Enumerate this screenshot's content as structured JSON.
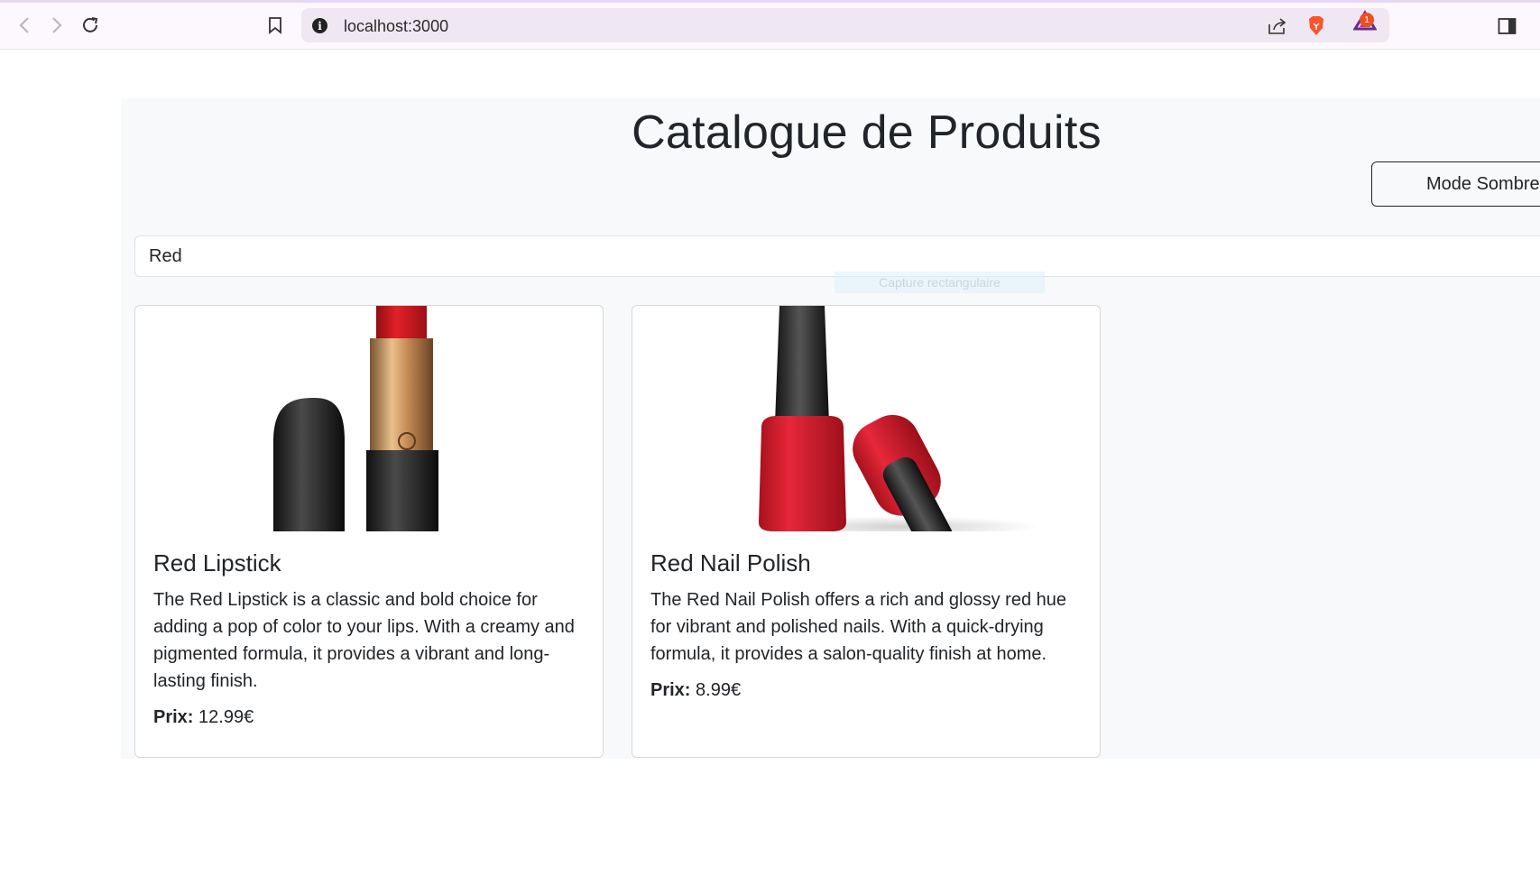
{
  "browser": {
    "url": "localhost:3000",
    "notification_count": "1",
    "icons": [
      "back-icon",
      "forward-icon",
      "reload-icon",
      "bookmark-icon",
      "site-info-icon",
      "share-icon",
      "brave-shield-icon",
      "brave-rewards-icon",
      "sidebar-icon"
    ]
  },
  "page": {
    "title": "Catalogue de Produits",
    "dark_mode_label": "Mode Sombre",
    "search_value": "Red",
    "capture_hint": "Capture rectangulaire"
  },
  "products": [
    {
      "name": "Red Lipstick",
      "description": "The Red Lipstick is a classic and bold choice for adding a pop of color to your lips. With a creamy and pigmented formula, it provides a vibrant and long-lasting finish.",
      "price_label": "Prix:",
      "price": "12.99€"
    },
    {
      "name": "Red Nail Polish",
      "description": "The Red Nail Polish offers a rich and glossy red hue for vibrant and polished nails. With a quick-drying formula, it provides a salon-quality finish at home.",
      "price_label": "Prix:",
      "price": "8.99€"
    }
  ],
  "colors": {
    "accent_red": "#d9283a",
    "text": "#212529",
    "page_bg": "#f8f9fa"
  }
}
